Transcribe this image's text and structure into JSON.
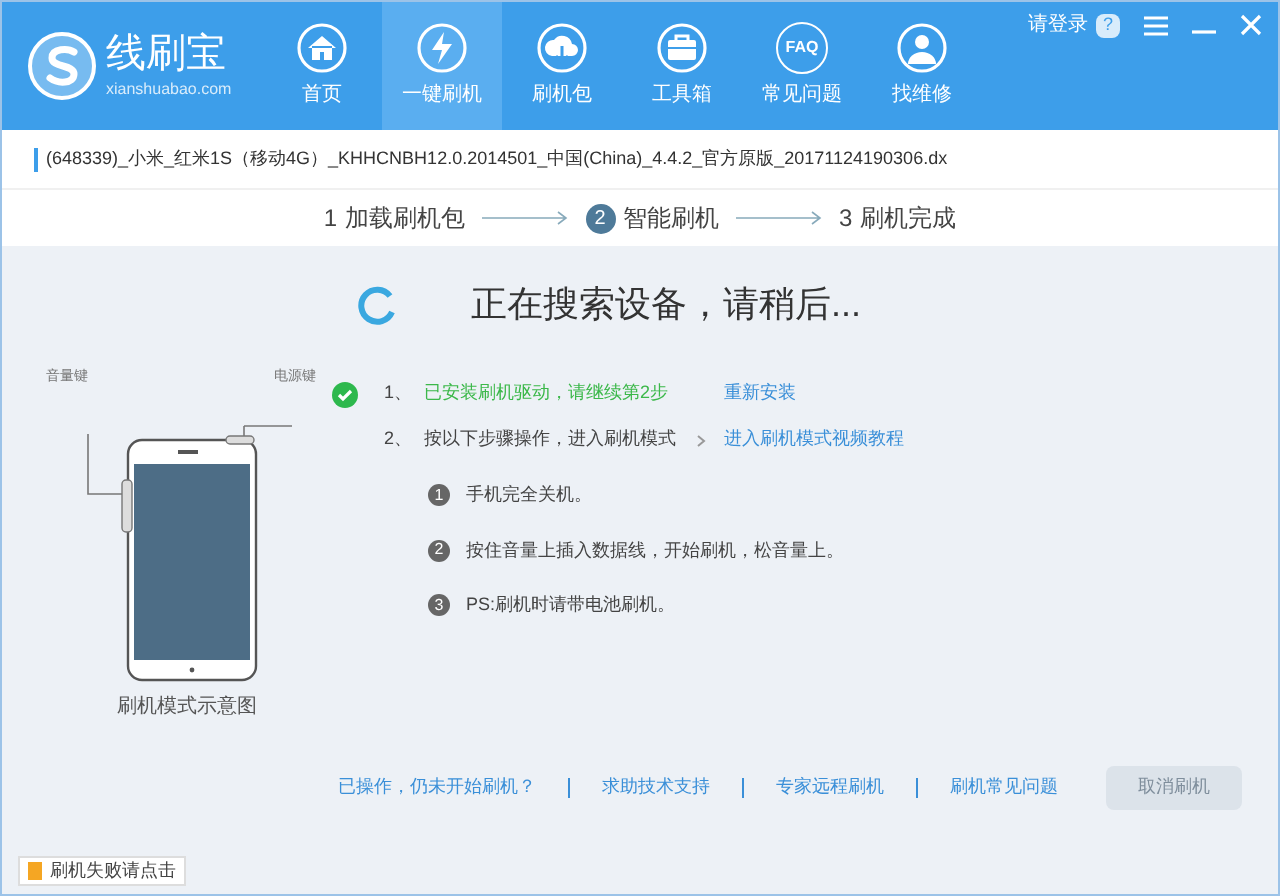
{
  "app": {
    "name": "线刷宝",
    "domain": "xianshuabao.com"
  },
  "nav": [
    {
      "label": "首页",
      "kind": "home",
      "selected": false
    },
    {
      "label": "一键刷机",
      "kind": "bolt",
      "selected": true
    },
    {
      "label": "刷机包",
      "kind": "cloud",
      "selected": false
    },
    {
      "label": "工具箱",
      "kind": "toolbox",
      "selected": false
    },
    {
      "label": "常见问题",
      "kind": "text",
      "icon_text": "FAQ",
      "selected": false
    },
    {
      "label": "找维修",
      "kind": "person",
      "selected": false
    }
  ],
  "window_controls": {
    "login": "请登录",
    "help": "?"
  },
  "file": "(648339)_小米_红米1S（移动4G）_KHHCNBH12.0.2014501_中国(China)_4.4.2_官方原版_20171124190306.dx",
  "steps": [
    {
      "number": "1",
      "label": "加载刷机包",
      "selected": false
    },
    {
      "number": "2",
      "label": "智能刷机",
      "selected": true
    },
    {
      "number": "3",
      "label": "刷机完成",
      "selected": false
    }
  ],
  "status": "正在搜索设备，请稍后...",
  "diagram": {
    "volume_label": "音量键",
    "power_label": "电源键",
    "caption": "刷机模式示意图"
  },
  "instructions": [
    {
      "number": "1、",
      "text": "已安装刷机驱动，请继续第2步",
      "done": true,
      "link": "重新安装"
    },
    {
      "number": "2、",
      "text": "按以下步骤操作，进入刷机模式",
      "done": false,
      "link": "进入刷机模式视频教程"
    }
  ],
  "substeps": [
    {
      "number": "1",
      "text": "手机完全关机。"
    },
    {
      "number": "2",
      "text": "按住音量上插入数据线，开始刷机，松音量上。"
    },
    {
      "number": "3",
      "text": "PS:刷机时请带电池刷机。"
    }
  ],
  "help_links": [
    "已操作，仍未开始刷机？",
    "求助技术支持",
    "专家远程刷机",
    "刷机常见问题"
  ],
  "cancel_button": {
    "label": "取消刷机",
    "disabled": true
  },
  "feedback": {
    "label": "刷机失败请点击"
  }
}
